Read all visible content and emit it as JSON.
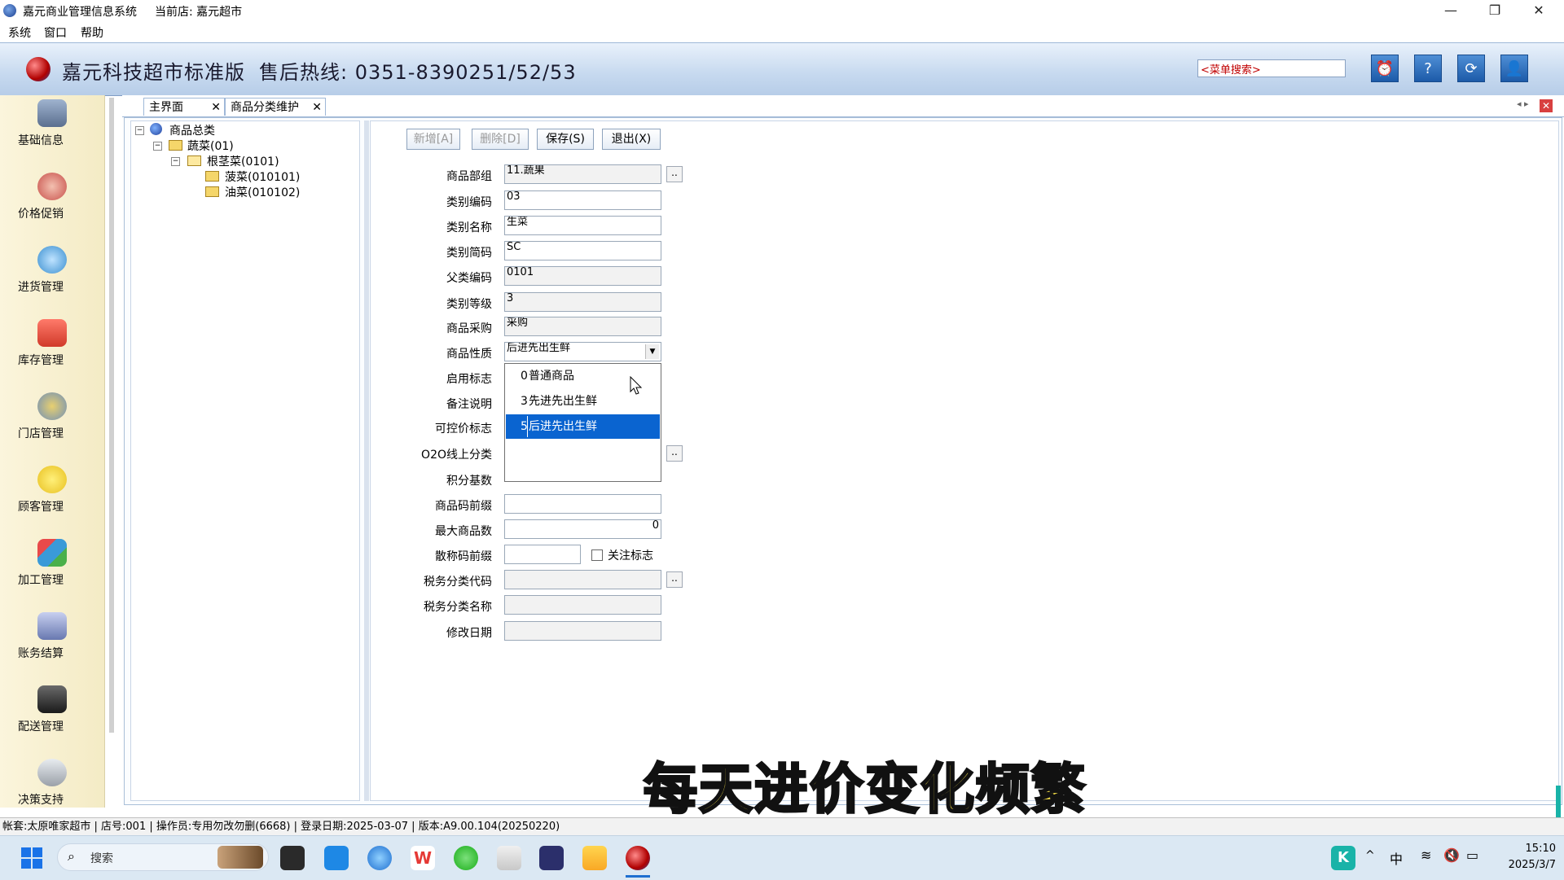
{
  "window": {
    "app_title": "嘉元商业管理信息系统",
    "current_store": "当前店: 嘉元超市",
    "minimize": "—",
    "restore": "❐",
    "close": "✕"
  },
  "menubar": [
    "系统",
    "窗口",
    "帮助"
  ],
  "banner": {
    "company": "嘉元科技超市标准版",
    "hotline": "售后热线: 0351-8390251/52/53",
    "menu_search_value": "<菜单搜索>"
  },
  "sidebar": {
    "items": [
      {
        "label": "基础信息",
        "icon": "user-card-icon",
        "color": "#5b6f8f"
      },
      {
        "label": "价格促销",
        "icon": "price-tag-icon",
        "color": "#c8504a"
      },
      {
        "label": "进货管理",
        "icon": "globe-arrow-icon",
        "color": "#3a8fd0"
      },
      {
        "label": "库存管理",
        "icon": "warehouse-icon",
        "color": "#d03a2a"
      },
      {
        "label": "门店管理",
        "icon": "shop-icon",
        "color": "#6f8fb8"
      },
      {
        "label": "顾客管理",
        "icon": "customer-icon",
        "color": "#e8c020"
      },
      {
        "label": "加工管理",
        "icon": "cubes-icon",
        "color": "#3a9ad8"
      },
      {
        "label": "账务结算",
        "icon": "ledger-icon",
        "color": "#6878b0"
      },
      {
        "label": "配送管理",
        "icon": "delivery-icon",
        "color": "#2a2a2a"
      },
      {
        "label": "决策支持",
        "icon": "decision-icon",
        "color": "#9aa0a8"
      }
    ]
  },
  "tabs": [
    {
      "label": "主界面",
      "close": "✕"
    },
    {
      "label": "商品分类维护",
      "close": "✕"
    }
  ],
  "tree": {
    "root": "商品总类",
    "level1": "蔬菜(01)",
    "level2": "根茎菜(0101)",
    "leaves": [
      "菠菜(010101)",
      "油菜(010102)"
    ]
  },
  "toolbar": {
    "add": "新增[A]",
    "delete": "删除[D]",
    "save": "保存(S)",
    "exit": "退出(X)"
  },
  "form": {
    "dept_label": "商品部组",
    "dept_value": "11.蔬果",
    "code_label": "类别编码",
    "code_value": "03",
    "name_label": "类别名称",
    "name_value": "生菜",
    "abbr_label": "类别简码",
    "abbr_value": "SC",
    "parent_label": "父类编码",
    "parent_value": "0101",
    "level_label": "类别等级",
    "level_value": "3",
    "purchase_label": "商品采购",
    "purchase_value": "采购",
    "nature_label": "商品性质",
    "nature_value": "后进先出生鲜",
    "enable_label": "启用标志",
    "remark_label": "备注说明",
    "pricectl_label": "可控价标志",
    "o2o_label": "O2O线上分类",
    "points_label": "积分基数",
    "prefix_label": "商品码前缀",
    "max_label": "最大商品数",
    "max_value": "0",
    "scale_label": "散称码前缀",
    "follow_label": "关注标志",
    "taxcode_label": "税务分类代码",
    "taxname_label": "税务分类名称",
    "modified_label": "修改日期"
  },
  "dropdown": {
    "options": [
      {
        "code": "0",
        "name": "普通商品",
        "selected": false
      },
      {
        "code": "3",
        "name": "先进先出生鲜",
        "selected": false
      },
      {
        "code": "5",
        "name": "后进先出生鲜",
        "selected": true
      }
    ],
    "highlight_color": "#0a64d0"
  },
  "subtitle": "每天进价变化频繁",
  "statusbar": "帐套:太原唯家超市 | 店号:001 | 操作员:专用勿改勿删(6668) | 登录日期:2025-03-07 | 版本:A9.00.104(20250220)",
  "taskbar": {
    "search_placeholder": "搜索",
    "ime": "中",
    "time": "15:10",
    "date": "2025/3/7"
  }
}
